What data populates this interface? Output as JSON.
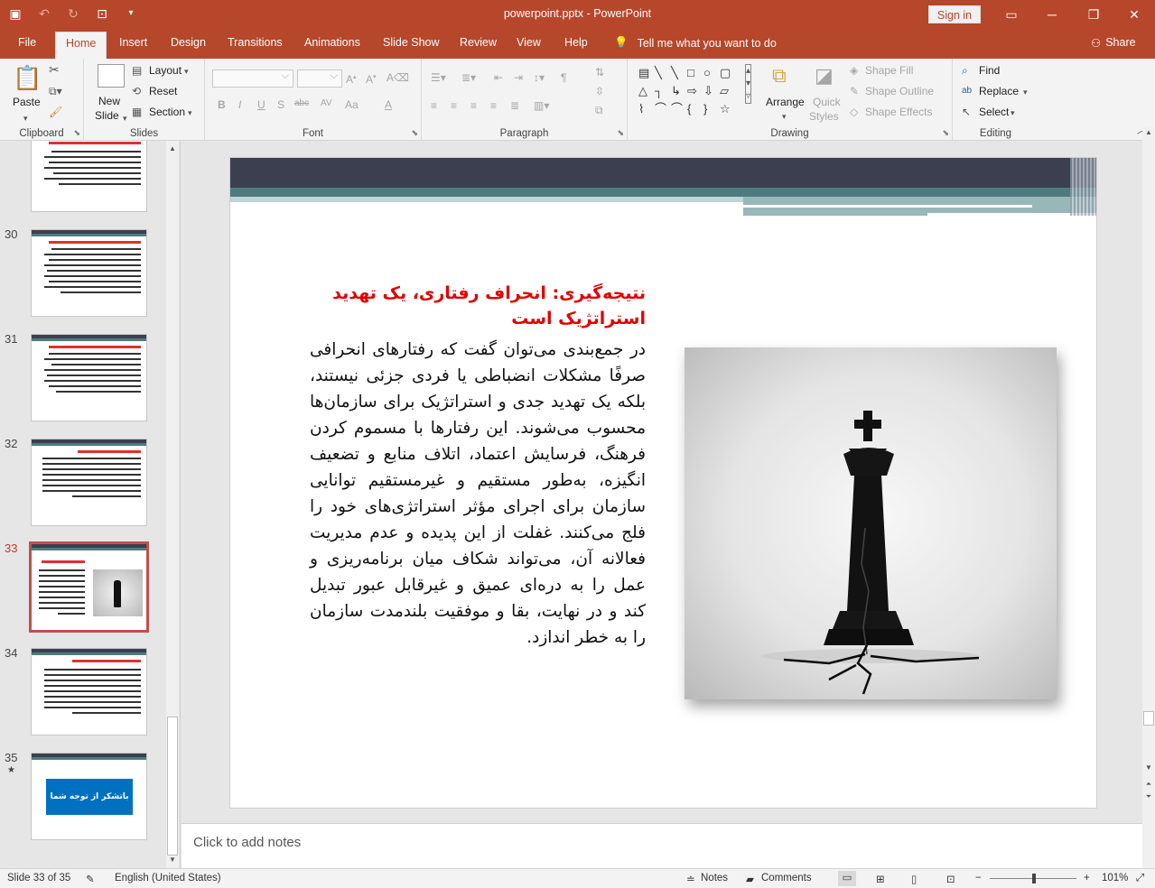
{
  "window": {
    "title": "powerpoint.pptx  -  PowerPoint",
    "sign_in": "Sign in"
  },
  "menu": {
    "tabs": [
      "File",
      "Home",
      "Insert",
      "Design",
      "Transitions",
      "Animations",
      "Slide Show",
      "Review",
      "View",
      "Help"
    ],
    "active_tab": "Home",
    "tell_me": "Tell me what you want to do",
    "share": "Share"
  },
  "ribbon": {
    "clipboard": {
      "paste": "Paste",
      "label": "Clipboard"
    },
    "slides": {
      "new_slide_1": "New",
      "new_slide_2": "Slide",
      "layout": "Layout",
      "reset": "Reset",
      "section": "Section",
      "label": "Slides"
    },
    "font": {
      "label": "Font",
      "bold": "B",
      "italic": "I",
      "underline": "U",
      "shadow": "S",
      "strike": "abc",
      "spacing": "AV",
      "case": "Aa",
      "color": "A",
      "grow": "A",
      "shrink": "A"
    },
    "paragraph": {
      "label": "Paragraph"
    },
    "drawing": {
      "arrange": "Arrange",
      "quick_styles_1": "Quick",
      "quick_styles_2": "Styles",
      "shape_fill": "Shape Fill",
      "shape_outline": "Shape Outline",
      "shape_effects": "Shape Effects",
      "label": "Drawing"
    },
    "editing": {
      "find": "Find",
      "replace": "Replace",
      "select": "Select",
      "label": "Editing"
    }
  },
  "thumbnails": [
    {
      "num": "30",
      "star": ""
    },
    {
      "num": "31",
      "star": ""
    },
    {
      "num": "32",
      "star": ""
    },
    {
      "num": "33",
      "star": ""
    },
    {
      "num": "34",
      "star": ""
    },
    {
      "num": "35",
      "star": "★"
    }
  ],
  "thumb35_text": "باتشکر از توجه شما",
  "slide": {
    "title": "نتیجه‌گیری: انحراف رفتاری، یک تهدید استراتژیک است",
    "body": "در جمع‌بندی می‌توان گفت که رفتارهای انحرافی صرفًا مشکلات انضباطی یا فردی جزئی نیستند، بلکه یک تهدید جدی و استراتژیک برای سازمان‌ها محسوب می‌شوند. این رفتارها با مسموم کردن فرهنگ، فرسایش اعتماد، اتلاف منابع و تضعیف انگیزه، به‌طور مستقیم و غیرمستقیم توانایی سازمان برای اجرای مؤثر استراتژی‌های خود را فلج می‌کنند. غفلت از این پدیده و عدم مدیریت فعالانه آن، می‌تواند شکاف میان برنامه‌ریزی و عمل را به دره‌ای عمیق و غیرقابل عبور تبدیل کند و در نهایت، بقا و موفقیت بلندمدت سازمان را به خطر اندازد."
  },
  "notes_placeholder": "Click to add notes",
  "status": {
    "slide_info": "Slide 33 of 35",
    "language": "English (United States)",
    "notes": "Notes",
    "comments": "Comments",
    "zoom": "101%",
    "zoom_level_fraction": 0.5
  },
  "colors": {
    "accent": "#b7472a",
    "title_red": "#e00000",
    "band_dark": "#3b3f50",
    "band_teal": "#4e7c7e",
    "thumb35_blue": "#0070c0"
  }
}
